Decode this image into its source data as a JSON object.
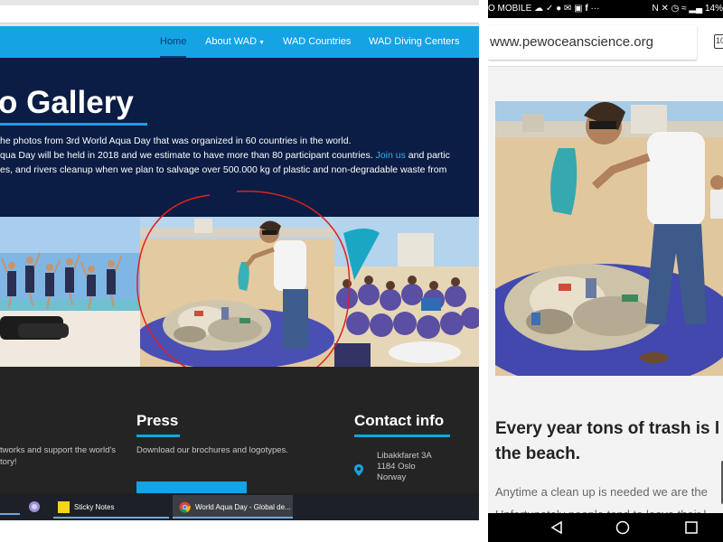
{
  "desktop": {
    "nav": {
      "items": [
        {
          "label": "Home",
          "active": true
        },
        {
          "label": "About WAD",
          "has_dropdown": true
        },
        {
          "label": "WAD Countries"
        },
        {
          "label": "WAD Diving Centers"
        }
      ]
    },
    "hero": {
      "title": "o Gallery",
      "line1": "he photos from 3rd World Aqua Day that was organized in 60 countries in the world.",
      "line2_pre": "qua Day will be held in 2018 and we estimate to have more than 80 participant countries.",
      "line2_link": "Join us",
      "line2_post": "and partic",
      "line3": "es, and rivers cleanup when we plan to salvage over 500.000 kg of plastic and non-degradable waste from"
    },
    "gallery": {
      "photos": [
        "group-jumping-beach-photo",
        "man-holding-trash-bag-photo",
        "volunteers-group-photo"
      ],
      "annotation": "red-hand-drawn-circle"
    },
    "footer": {
      "col1_line1": "tworks and support the world's",
      "col1_line2": "tory!",
      "press_title": "Press",
      "press_text": "Download our brochures and logotypes.",
      "contact_title": "Contact info",
      "address_line1": "Libakkfaret 3A",
      "address_line2": "1184 Oslo",
      "address_line3": "Norway"
    },
    "taskbar": {
      "items": [
        {
          "label": "Sticky Notes",
          "icon": "sticky-notes-icon"
        },
        {
          "label": "World Aqua Day - Global de...",
          "icon": "chrome-icon"
        }
      ]
    },
    "colors": {
      "accent": "#14a3e3",
      "hero_bg": "#0b1d44",
      "footer_bg": "#242424"
    }
  },
  "mobile": {
    "status": {
      "carrier": "O MOBILE",
      "battery": "14%"
    },
    "url": "www.pewoceanscience.org",
    "tabs_count": "10",
    "heading": "Every year tons of trash is l on the beach.",
    "body_line1": "Anytime a clean up is needed we are the",
    "body_line2": "Unfortunately people tend to leave their l"
  }
}
